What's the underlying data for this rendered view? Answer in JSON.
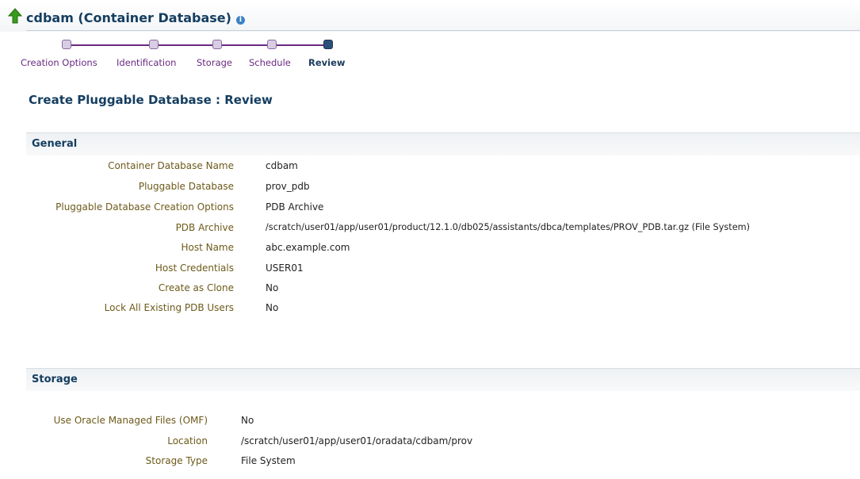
{
  "header": {
    "title": "cdbam (Container Database)",
    "info_glyph": "i"
  },
  "train": {
    "steps": [
      {
        "label": "Creation Options",
        "state": "visited"
      },
      {
        "label": "Identification",
        "state": "visited"
      },
      {
        "label": "Storage",
        "state": "visited"
      },
      {
        "label": "Schedule",
        "state": "visited"
      },
      {
        "label": "Review",
        "state": "current"
      }
    ]
  },
  "page": {
    "heading": "Create Pluggable Database : Review"
  },
  "general": {
    "title": "General",
    "rows": [
      {
        "label": "Container Database Name",
        "value": "cdbam"
      },
      {
        "label": "Pluggable Database",
        "value": "prov_pdb"
      },
      {
        "label": "Pluggable Database Creation Options",
        "value": "PDB Archive"
      },
      {
        "label": "PDB Archive",
        "value": "/scratch/user01/app/user01/product/12.1.0/db025/assistants/dbca/templates/PROV_PDB.tar.gz (File System)"
      },
      {
        "label": "Host Name",
        "value": "abc.example.com"
      },
      {
        "label": "Host Credentials",
        "value": "USER01"
      },
      {
        "label": "Create as Clone",
        "value": "No"
      },
      {
        "label": "Lock All Existing PDB Users",
        "value": "No"
      }
    ]
  },
  "storage": {
    "title": "Storage",
    "rows": [
      {
        "label": "Use Oracle Managed Files (OMF)",
        "value": "No"
      },
      {
        "label": "Location",
        "value": "/scratch/user01/app/user01/oradata/cdbam/prov"
      },
      {
        "label": "Storage Type",
        "value": "File System"
      }
    ]
  },
  "colors": {
    "title": "#153e60",
    "train": "#6b2a82",
    "label": "#6d5a1a",
    "up_arrow": "#3a9a1e"
  }
}
